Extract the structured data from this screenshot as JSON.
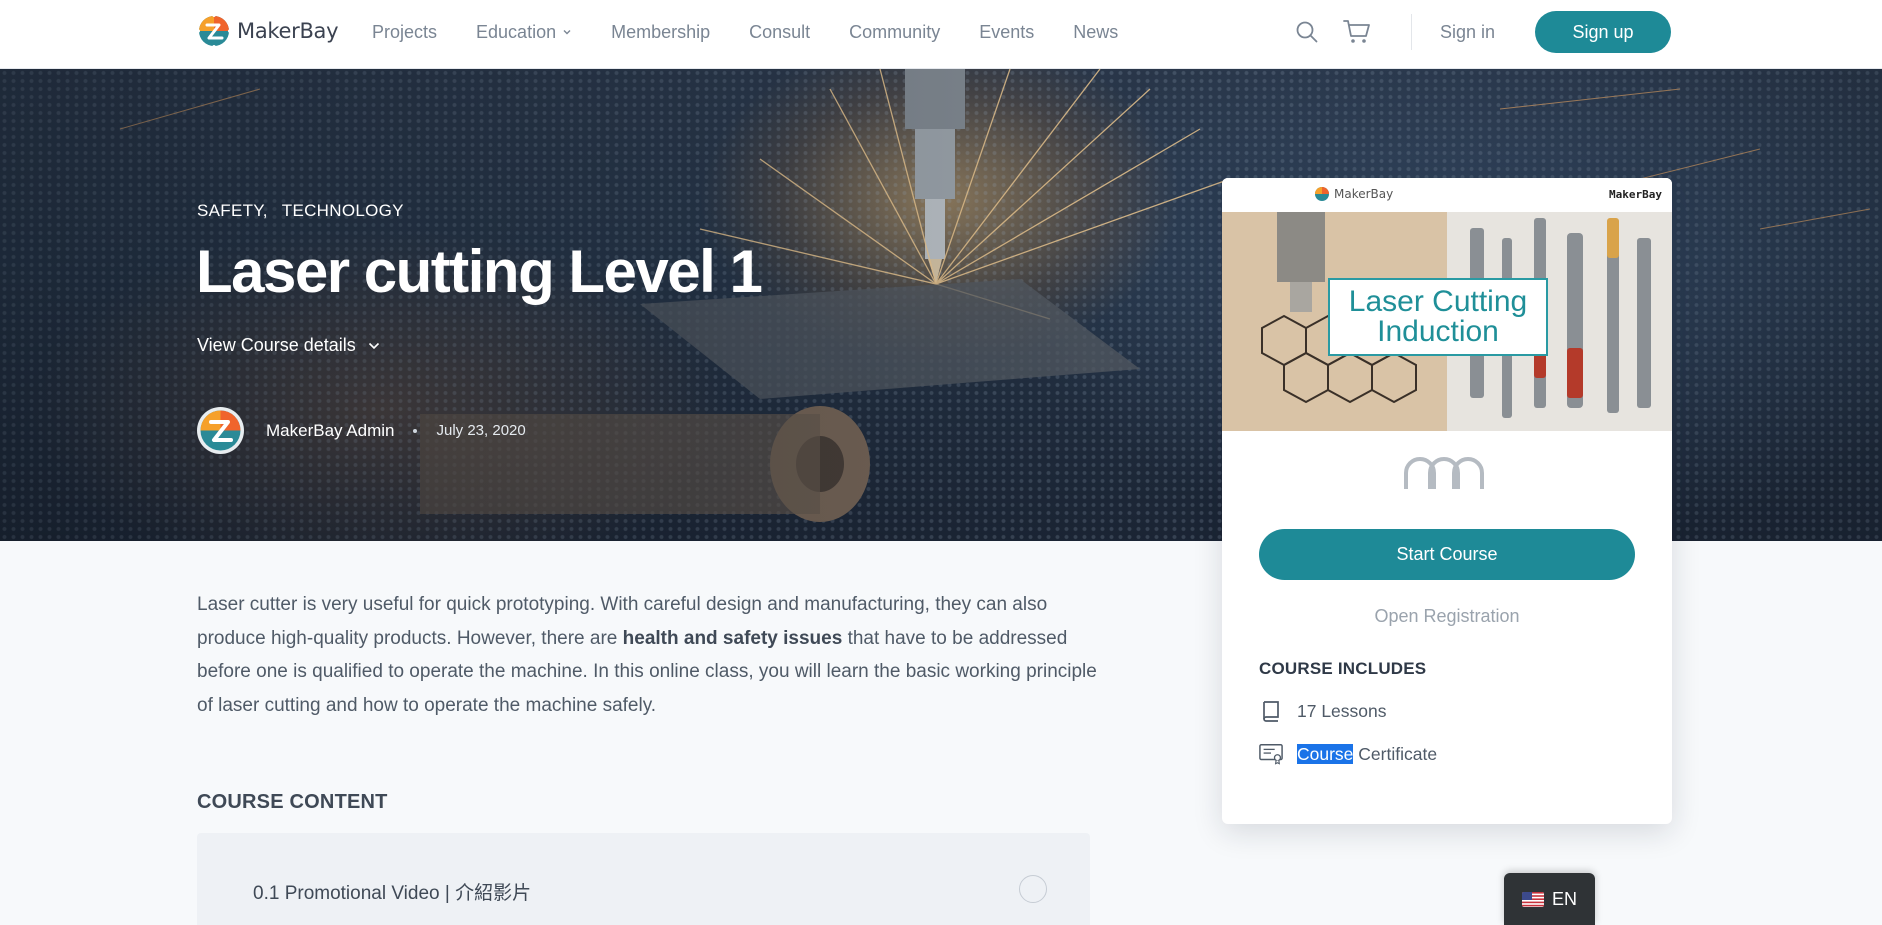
{
  "header": {
    "logo_text": "MakerBay",
    "nav": [
      "Projects",
      "Education",
      "Membership",
      "Consult",
      "Community",
      "Events",
      "News"
    ],
    "sign_in": "Sign in",
    "sign_up": "Sign up",
    "icons": [
      "search-icon",
      "cart-icon",
      "chevron-down-icon"
    ]
  },
  "hero": {
    "categories": [
      "SAFETY,",
      "TECHNOLOGY"
    ],
    "title": "Laser cutting Level 1",
    "details_link": "View Course details",
    "author": "MakerBay Admin",
    "date": "July 23, 2020"
  },
  "main": {
    "intro_before": "Laser cutter is very useful for quick prototyping. With careful design and manufacturing, they can also produce high-quality products. However, there are ",
    "intro_bold": "health and safety issues",
    "intro_after": " that have to be addressed before one is qualified to operate the machine. In this online class, you will learn the basic working principle of laser cutting and how to operate the machine safely.",
    "course_content_heading": "COURSE CONTENT",
    "lessons": [
      {
        "title": "0.1 Promotional Video | 介紹影片"
      }
    ]
  },
  "card": {
    "thumb_logo": "MakerBay",
    "thumb_brand": "MakerBay",
    "thumb_title_line1": "Laser Cutting",
    "thumb_title_line2": "Induction",
    "start_button": "Start Course",
    "open_registration": "Open Registration",
    "includes_heading": "COURSE INCLUDES",
    "includes": [
      {
        "icon": "book-icon",
        "label": "17 Lessons"
      },
      {
        "icon": "certificate-icon",
        "label_selected": "Course",
        "label_rest": " Certificate"
      }
    ]
  },
  "language": {
    "code": "EN",
    "flag": "us-flag-icon"
  },
  "colors": {
    "accent": "#1e8a97",
    "text": "#4a5563",
    "background": "#f7f9fb"
  }
}
